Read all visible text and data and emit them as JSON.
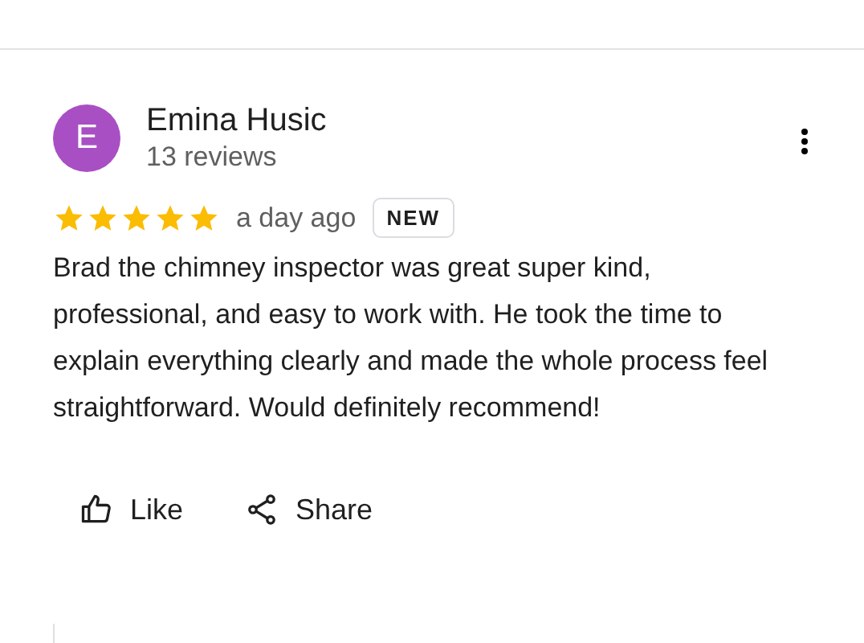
{
  "review": {
    "avatar_letter": "E",
    "color": "#a94fc4",
    "author": "Emina Husic",
    "review_count": "13 reviews",
    "stars": 5,
    "time": "a day ago",
    "badge": "NEW",
    "text": "Brad the chimney inspector was great super kind, professional, and easy to work with. He took the time to explain everything clearly and made the whole process feel straightforward. Would definitely recommend!"
  },
  "actions": [
    {
      "kind": "like",
      "label": "Like"
    },
    {
      "kind": "share",
      "label": "Share"
    }
  ]
}
